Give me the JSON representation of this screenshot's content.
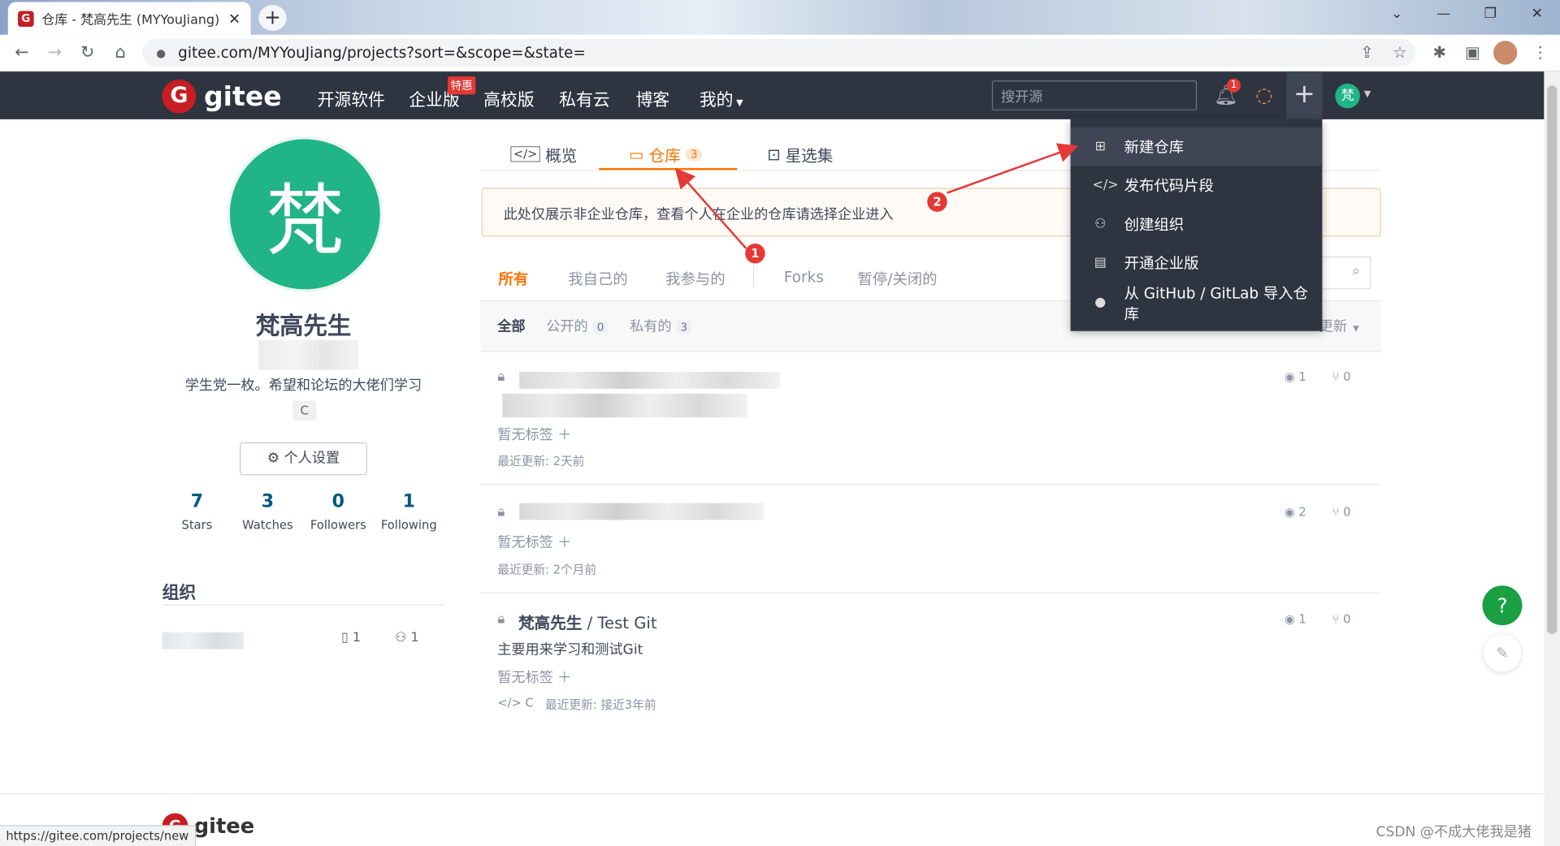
{
  "browser": {
    "tab_title": "仓库 - 梵高先生 (MYYouJiang) · ",
    "tab_close": "✕",
    "new_tab": "+",
    "url": "gitee.com/MYYouJiang/projects?sort=&scope=&state=",
    "status_url": "https://gitee.com/projects/new"
  },
  "header": {
    "logo_text": "gitee",
    "nav": [
      "开源软件",
      "企业版",
      "高校版",
      "私有云",
      "博客",
      "我的"
    ],
    "hot_badge": "特惠",
    "search_placeholder": "搜开源",
    "notification_count": "1",
    "avatar_char": "梵"
  },
  "profile": {
    "avatar_char": "梵",
    "name": "梵高先生",
    "bio": "学生党一枚。希望和论坛的大佬们学习",
    "lang_tag": "C",
    "settings_button": "个人设置",
    "stats": [
      {
        "value": "7",
        "label": "Stars"
      },
      {
        "value": "3",
        "label": "Watches"
      },
      {
        "value": "0",
        "label": "Followers"
      },
      {
        "value": "1",
        "label": "Following"
      }
    ],
    "org_title": "组织",
    "org_repos": "1",
    "org_members": "1"
  },
  "main_tabs": [
    {
      "label": "概览"
    },
    {
      "label": "仓库",
      "count": "3"
    },
    {
      "label": "星选集"
    }
  ],
  "notice": "此处仅展示非企业仓库，查看个人在企业的仓库请选择企业进入",
  "filter_tabs": [
    "所有",
    "我自己的",
    "我参与的",
    "Forks",
    "暂停/关闭的"
  ],
  "scope_tabs": [
    {
      "label": "全部"
    },
    {
      "label": "公开的",
      "count": "0"
    },
    {
      "label": "私有的",
      "count": "3"
    }
  ],
  "sort_label": "更新",
  "repos": [
    {
      "title_owner": "",
      "title_name": "",
      "description": "",
      "tags": "暂无标签",
      "lang": "",
      "updated": "最近更新: 2天前",
      "watch": "1",
      "fork": "0"
    },
    {
      "title_owner": "",
      "title_name": "",
      "description": "",
      "tags": "暂无标签",
      "lang": "",
      "updated": "最近更新: 2个月前",
      "watch": "2",
      "fork": "0"
    },
    {
      "title_owner": "梵高先生",
      "title_name": " / Test Git",
      "description": "主要用来学习和测试Git",
      "tags": "暂无标签",
      "lang": "C",
      "updated": "最近更新: 接近3年前",
      "watch": "1",
      "fork": "0"
    }
  ],
  "dropdown": [
    {
      "icon": "plus-square-icon",
      "label": "新建仓库"
    },
    {
      "icon": "code-icon",
      "label": "发布代码片段"
    },
    {
      "icon": "group-icon",
      "label": "创建组织"
    },
    {
      "icon": "building-icon",
      "label": "开通企业版"
    },
    {
      "icon": "github-icon",
      "label": "从 GitHub / GitLab 导入仓库"
    }
  ],
  "annotations": [
    "1",
    "2"
  ],
  "footer_logo": "gitee",
  "watermark": "CSDN @不成大佬我是猪",
  "colors": {
    "accent": "#fe7300",
    "brand": "#c71d23",
    "header": "#2e3440",
    "avatar": "#20b486",
    "annotation": "#e53935"
  }
}
